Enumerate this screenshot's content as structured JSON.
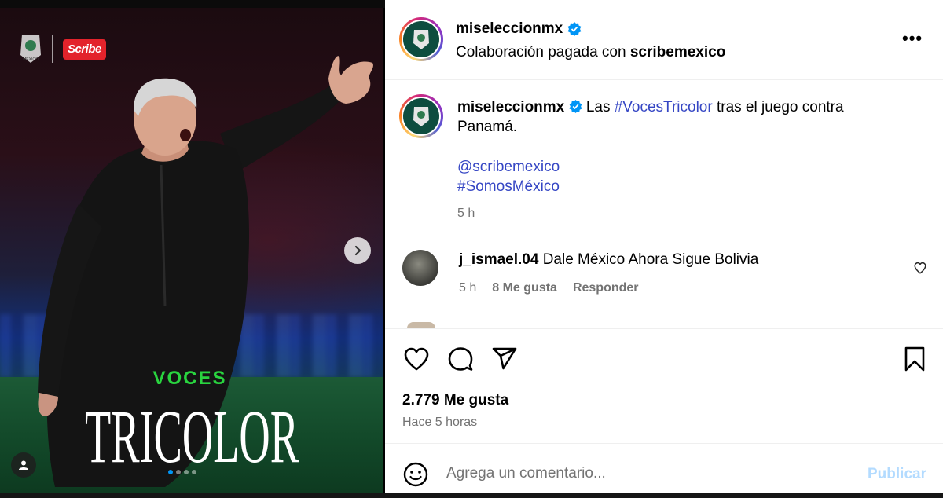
{
  "header": {
    "username": "miseleccionmx",
    "paid_prefix": "Colaboración pagada con",
    "partner": "scribemexico",
    "more_label": "•••"
  },
  "media": {
    "brand_scribe": "Scribe",
    "brand_mx": "MÉXICO",
    "title_top": "VOCES",
    "title_main": "TRICOLOR",
    "slide_count": 4,
    "current_slide": 1
  },
  "caption": {
    "username": "miseleccionmx",
    "text_before": "Las",
    "hashtag1": "#VocesTricolor",
    "text_after": "tras el juego contra Panamá.",
    "mention": "@scribemexico",
    "hashtag2": "#SomosMéxico",
    "time": "5 h"
  },
  "comment": {
    "username": "j_ismael.04",
    "text": "Dale México Ahora Sigue Bolivia",
    "time": "5 h",
    "likes": "8 Me gusta",
    "reply": "Responder"
  },
  "stats": {
    "likes": "2.779 Me gusta",
    "posted": "Hace 5 horas"
  },
  "composer": {
    "placeholder": "Agrega un comentario...",
    "publish": "Publicar"
  },
  "colors": {
    "accent": "#0095f6",
    "link": "#3546c4",
    "green_text": "#29d43f",
    "scribe_red": "#e3232b"
  }
}
